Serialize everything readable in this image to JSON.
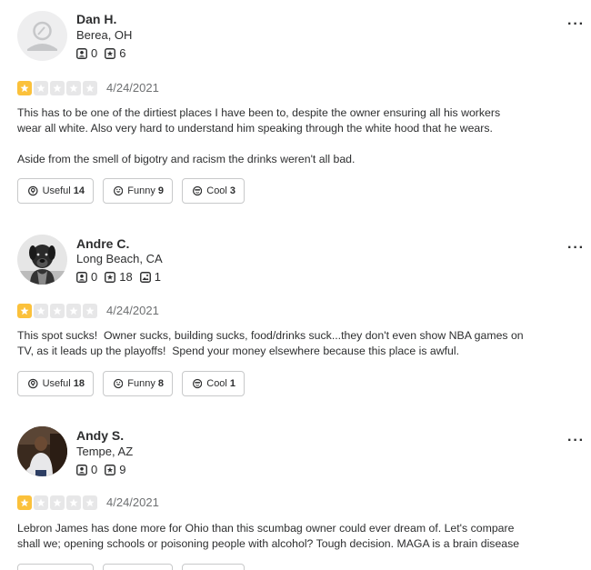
{
  "reviews": [
    {
      "user": {
        "name": "Dan H.",
        "location": "Berea, OH",
        "friends": "0",
        "reviews": "6",
        "photos": null
      },
      "rating": 1,
      "date": "4/24/2021",
      "paragraphs": [
        "This has to be one of the dirtiest places I have been to, despite the owner ensuring all his workers wear all white. Also very hard to understand him speaking through the white hood that he wears.",
        "Aside from the smell of bigotry and racism the drinks weren't all bad."
      ],
      "useful": {
        "label": "Useful",
        "count": "14"
      },
      "funny": {
        "label": "Funny",
        "count": "9"
      },
      "cool": {
        "label": "Cool",
        "count": "3"
      }
    },
    {
      "user": {
        "name": "Andre C.",
        "location": "Long Beach, CA",
        "friends": "0",
        "reviews": "18",
        "photos": "1"
      },
      "rating": 1,
      "date": "4/24/2021",
      "paragraphs": [
        "This spot sucks!  Owner sucks, building sucks, food/drinks suck...they don't even show NBA games on TV, as it leads up the playoffs!  Spend your money elsewhere because this place is awful."
      ],
      "useful": {
        "label": "Useful",
        "count": "18"
      },
      "funny": {
        "label": "Funny",
        "count": "8"
      },
      "cool": {
        "label": "Cool",
        "count": "1"
      }
    },
    {
      "user": {
        "name": "Andy S.",
        "location": "Tempe, AZ",
        "friends": "0",
        "reviews": "9",
        "photos": null
      },
      "rating": 1,
      "date": "4/24/2021",
      "paragraphs": [
        "Lebron James has done more for Ohio than this scumbag owner could ever dream of. Let's compare shall we; opening schools or poisoning people with alcohol? Tough decision. MAGA is a brain disease"
      ]
    }
  ],
  "more_icon": "···",
  "colors": {
    "star_filled": "#fbc13b",
    "star_empty": "#e7e7e8",
    "border": "#c8c9ca"
  }
}
